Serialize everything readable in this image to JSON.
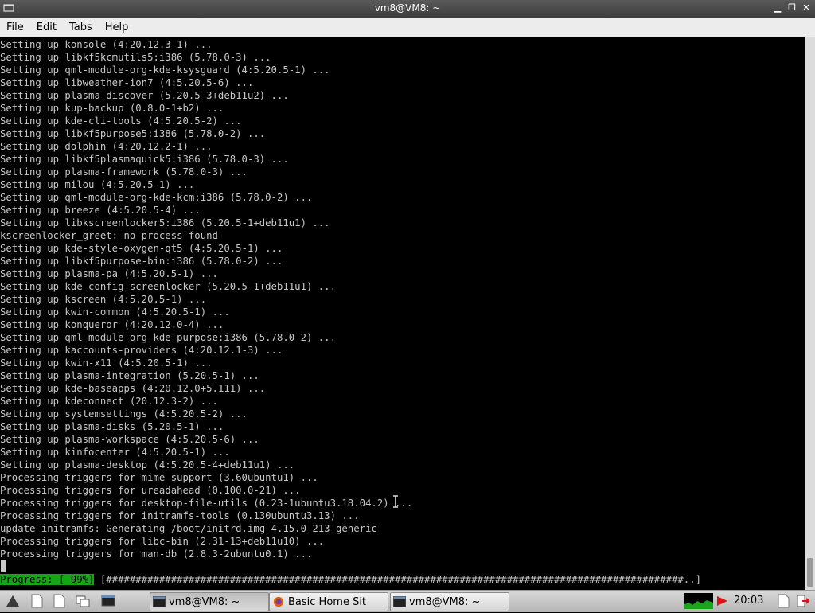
{
  "window": {
    "title": "vm8@VM8: ~"
  },
  "menu": {
    "items": [
      "File",
      "Edit",
      "Tabs",
      "Help"
    ]
  },
  "terminal": {
    "lines": [
      "Setting up konsole (4:20.12.3-1) ...",
      "Setting up libkf5kcmutils5:i386 (5.78.0-3) ...",
      "Setting up qml-module-org-kde-ksysguard (4:5.20.5-1) ...",
      "Setting up libweather-ion7 (4:5.20.5-6) ...",
      "Setting up plasma-discover (5.20.5-3+deb11u2) ...",
      "Setting up kup-backup (0.8.0-1+b2) ...",
      "Setting up kde-cli-tools (4:5.20.5-2) ...",
      "Setting up libkf5purpose5:i386 (5.78.0-2) ...",
      "Setting up dolphin (4:20.12.2-1) ...",
      "Setting up libkf5plasmaquick5:i386 (5.78.0-3) ...",
      "Setting up plasma-framework (5.78.0-3) ...",
      "Setting up milou (4:5.20.5-1) ...",
      "Setting up qml-module-org-kde-kcm:i386 (5.78.0-2) ...",
      "Setting up breeze (4:5.20.5-4) ...",
      "Setting up libkscreenlocker5:i386 (5.20.5-1+deb11u1) ...",
      "kscreenlocker_greet: no process found",
      "Setting up kde-style-oxygen-qt5 (4:5.20.5-1) ...",
      "Setting up libkf5purpose-bin:i386 (5.78.0-2) ...",
      "Setting up plasma-pa (4:5.20.5-1) ...",
      "Setting up kde-config-screenlocker (5.20.5-1+deb11u1) ...",
      "Setting up kscreen (4:5.20.5-1) ...",
      "Setting up kwin-common (4:5.20.5-1) ...",
      "Setting up konqueror (4:20.12.0-4) ...",
      "Setting up qml-module-org-kde-purpose:i386 (5.78.0-2) ...",
      "Setting up kaccounts-providers (4:20.12.1-3) ...",
      "Setting up kwin-x11 (4:5.20.5-1) ...",
      "Setting up plasma-integration (5.20.5-1) ...",
      "Setting up kde-baseapps (4:20.12.0+5.111) ...",
      "Setting up kdeconnect (20.12.3-2) ...",
      "Setting up systemsettings (4:5.20.5-2) ...",
      "Setting up plasma-disks (5.20.5-1) ...",
      "Setting up plasma-workspace (4:5.20.5-6) ...",
      "Setting up kinfocenter (4:5.20.5-1) ...",
      "Setting up plasma-desktop (4:5.20.5-4+deb11u1) ...",
      "Processing triggers for mime-support (3.60ubuntu1) ...",
      "Processing triggers for ureadahead (0.100.0-21) ...",
      "Processing triggers for desktop-file-utils (0.23-1ubuntu3.18.04.2) ...",
      "Processing triggers for initramfs-tools (0.130ubuntu3.13) ...",
      "update-initramfs: Generating /boot/initrd.img-4.15.0-213-generic",
      "Processing triggers for libc-bin (2.31-13+deb11u10) ...",
      "Processing triggers for man-db (2.8.3-2ubuntu0.1) ..."
    ],
    "progress_label": "Progress: [ 99%]",
    "progress_bar": " [##################################################################################################..]",
    "progress_percent": 99
  },
  "taskbar": {
    "tasks": [
      {
        "label": "vm8@VM8: ~",
        "icon": "terminal-icon"
      },
      {
        "label": "Basic Home Sit",
        "icon": "firefox-icon"
      },
      {
        "label": "vm8@VM8: ~",
        "icon": "terminal-icon"
      }
    ],
    "clock": "20:03"
  }
}
